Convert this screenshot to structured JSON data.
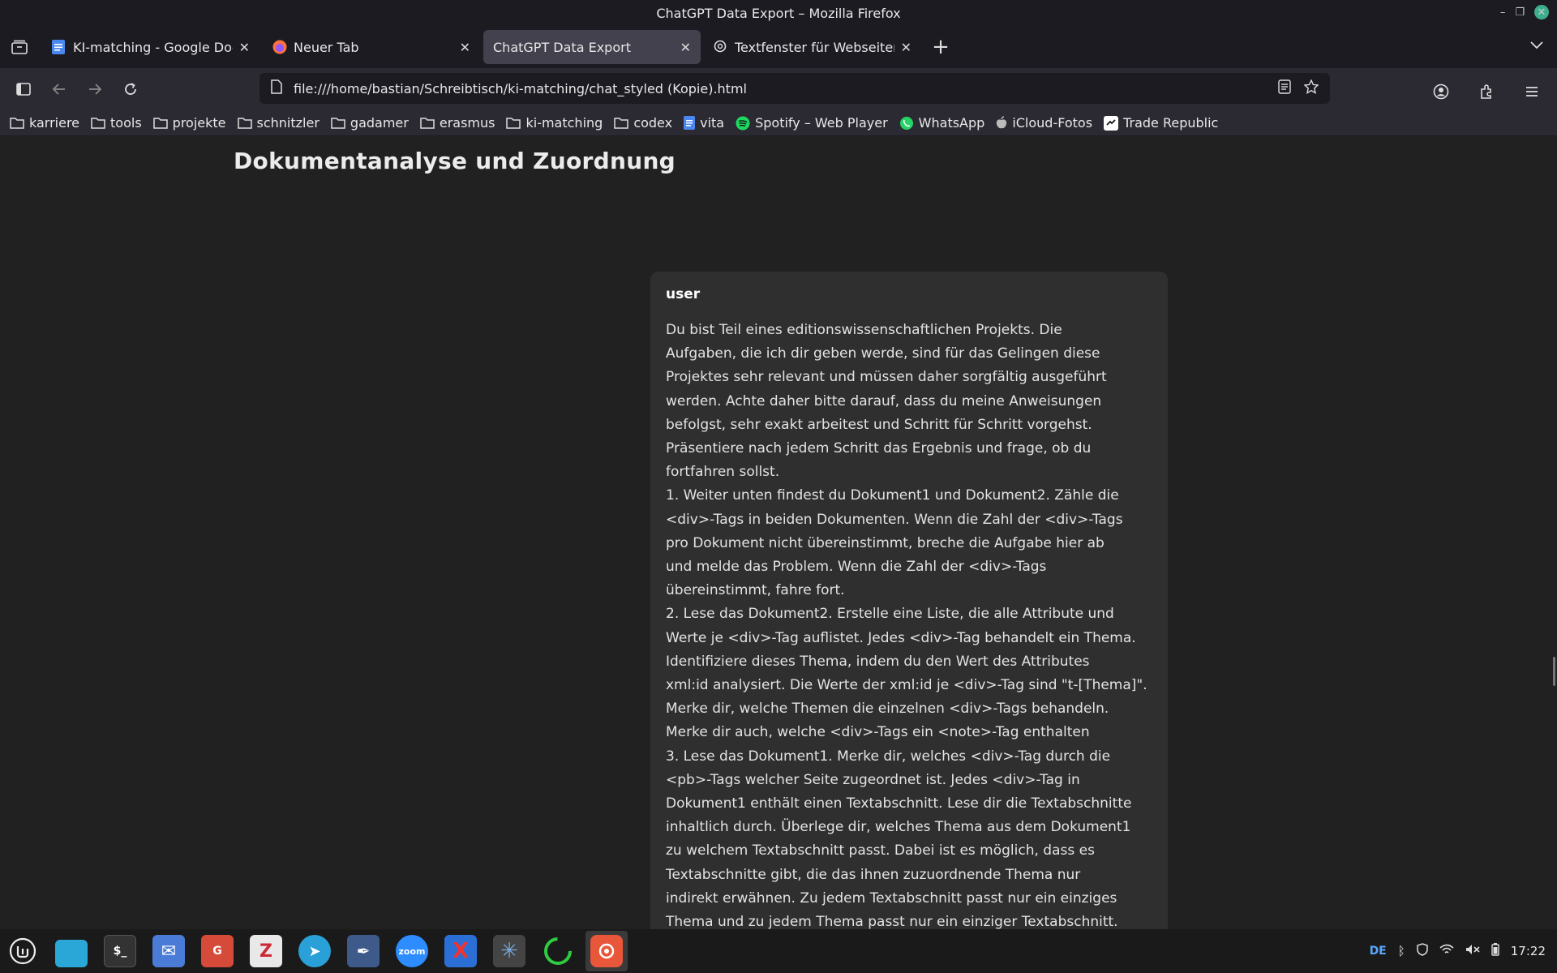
{
  "window": {
    "title": "ChatGPT Data Export – Mozilla Firefox"
  },
  "tabs": [
    {
      "label": "KI-matching - Google Docs",
      "icon": "google-docs-icon",
      "active": false
    },
    {
      "label": "Neuer Tab",
      "icon": "firefox-icon",
      "active": false
    },
    {
      "label": "ChatGPT Data Export",
      "icon": "",
      "active": true
    },
    {
      "label": "Textfenster für Webseiten",
      "icon": "openai-icon",
      "active": false
    }
  ],
  "urlbar": {
    "url": "file:///home/bastian/Schreibtisch/ki-matching/chat_styled (Kopie).html"
  },
  "bookmarks": [
    {
      "label": "karriere",
      "icon": "folder-icon"
    },
    {
      "label": "tools",
      "icon": "folder-icon"
    },
    {
      "label": "projekte",
      "icon": "folder-icon"
    },
    {
      "label": "schnitzler",
      "icon": "folder-icon"
    },
    {
      "label": "gadamer",
      "icon": "folder-icon"
    },
    {
      "label": "erasmus",
      "icon": "folder-icon"
    },
    {
      "label": "ki-matching",
      "icon": "folder-icon"
    },
    {
      "label": "codex",
      "icon": "folder-icon"
    },
    {
      "label": "vita",
      "icon": "google-docs-icon"
    },
    {
      "label": "Spotify – Web Player",
      "icon": "spotify-icon"
    },
    {
      "label": "WhatsApp",
      "icon": "whatsapp-icon"
    },
    {
      "label": "iCloud-Fotos",
      "icon": "apple-icon"
    },
    {
      "label": "Trade Republic",
      "icon": "trade-republic-icon"
    }
  ],
  "page": {
    "title": "Dokumentanalyse und Zuordnung",
    "message": {
      "role": "user",
      "text": "Du bist Teil eines editionswissenschaftlichen Projekts. Die\nAufgaben, die ich dir geben werde, sind für das Gelingen diese\nProjektes sehr relevant und müssen daher sorgfältig ausgeführt\nwerden. Achte daher bitte darauf, dass du meine Anweisungen\nbefolgst, sehr exakt arbeitest und Schritt für Schritt vorgehst.\nPräsentiere nach jedem Schritt das Ergebnis und frage, ob du\nfortfahren sollst.\n1. Weiter unten findest du Dokument1 und Dokument2. Zähle die\n<div>-Tags in beiden Dokumenten. Wenn die Zahl der <div>-Tags\npro Dokument nicht übereinstimmt, breche die Aufgabe hier ab\nund melde das Problem. Wenn die Zahl der <div>-Tags\nübereinstimmt, fahre fort.\n2. Lese das Dokument2. Erstelle eine Liste, die alle Attribute und\nWerte je <div>-Tag auflistet. Jedes <div>-Tag behandelt ein Thema.\nIdentifiziere dieses Thema, indem du den Wert des Attributes\nxml:id analysiert. Die Werte der xml:id je <div>-Tag sind \"t-[Thema]\".\nMerke dir, welche Themen die einzelnen <div>-Tags behandeln.\nMerke dir auch, welche <div>-Tags ein <note>-Tag enthalten\n3. Lese das Dokument1. Merke dir, welches <div>-Tag durch die\n<pb>-Tags welcher Seite zugeordnet ist. Jedes <div>-Tag in\nDokument1 enthält einen Textabschnitt. Lese dir die Textabschnitte\ninhaltlich durch. Überlege dir, welches Thema aus dem Dokument1\nzu welchem Textabschnitt passt. Dabei ist es möglich, dass es\nTextabschnitte gibt, die das ihnen zuzuordnende Thema nur\nindirekt erwähnen. Zu jedem Textabschnitt passt nur ein einziges\nThema und zu jedem Thema passt nur ein einziger Textabschnitt."
    }
  },
  "taskbar": {
    "apps": [
      {
        "name": "files-app",
        "label": "",
        "color": "#2aa7d6"
      },
      {
        "name": "terminal-app",
        "label": "$_",
        "color": "#333333"
      },
      {
        "name": "mail-app",
        "label": "✉",
        "color": "#4a7bd6"
      },
      {
        "name": "gimp-app",
        "label": "G",
        "color": "#d64a3a"
      },
      {
        "name": "zotero-app",
        "label": "Z",
        "color": "#e8e8e8"
      },
      {
        "name": "telegram-app",
        "label": "➤",
        "color": "#2aa0d8"
      },
      {
        "name": "pen-app",
        "label": "✒",
        "color": "#3d5a8a"
      },
      {
        "name": "zoom-app",
        "label": "zoom",
        "color": "#2d8cff"
      },
      {
        "name": "x-app",
        "label": "X",
        "color": "#2b6fd6"
      },
      {
        "name": "network-app",
        "label": "✳",
        "color": "#444444"
      },
      {
        "name": "loader-app",
        "label": "◌",
        "color": "#1a1a1a"
      },
      {
        "name": "firefox-app",
        "label": "◉",
        "color": "#e8573a"
      }
    ],
    "tray": {
      "lang": "DE",
      "time": "17:22"
    }
  }
}
